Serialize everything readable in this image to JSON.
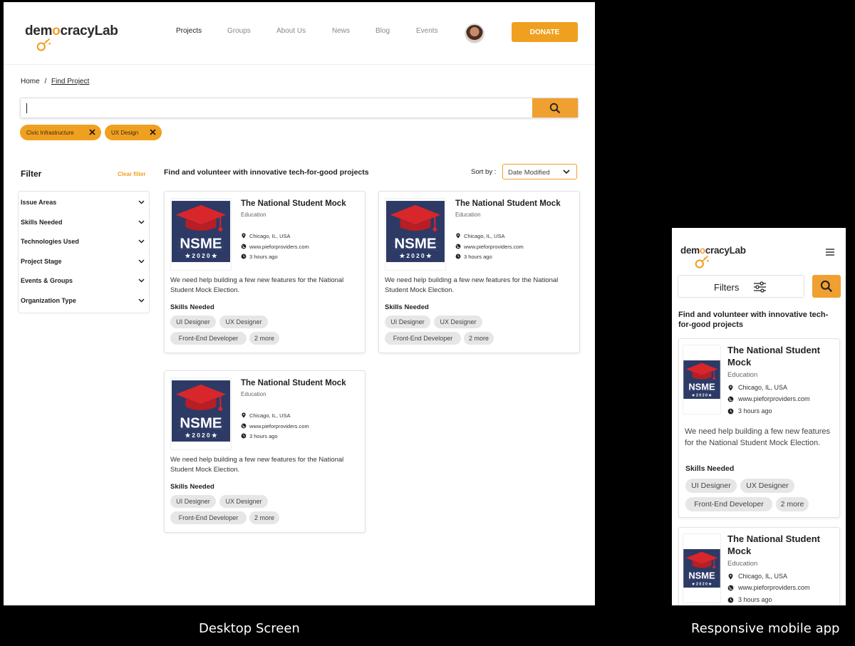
{
  "brand": {
    "logo_text_pre": "dem",
    "logo_text_o": "o",
    "logo_text_post": "cracyLab",
    "accent_color": "#f0a020"
  },
  "nav": {
    "items": [
      "Projects",
      "Groups",
      "About Us",
      "News",
      "Blog",
      "Events"
    ],
    "donate_label": "DONATE"
  },
  "breadcrumb": {
    "home": "Home",
    "separator": "/",
    "current": "Find Project"
  },
  "search": {
    "value": "",
    "icon": "search-icon"
  },
  "active_filters": [
    {
      "label": "Civic Infrastructure"
    },
    {
      "label": "UX Design"
    }
  ],
  "filter": {
    "title": "Filter",
    "clear_label": "Clear filter",
    "sections": [
      "Issue Areas",
      "Skills Needed",
      "Technologies Used",
      "Project Stage",
      "Events & Groups",
      "Organization Type"
    ]
  },
  "results": {
    "headline": "Find and volunteer with innovative tech-for-good projects",
    "sort_label": "Sort by :",
    "sort_value": "Date Modified"
  },
  "project": {
    "title": "The National Student Mock",
    "category": "Education",
    "location": "Chicago, IL, USA",
    "website": "www.pieforproviders.com",
    "updated": "3 hours ago",
    "description": "We need help building a few new features for the National Student Mock Election.",
    "skills_heading": "Skills Needed",
    "skills": [
      "UI Designer",
      "UX Designer",
      "Front-End Developer",
      "2 more"
    ],
    "logo_text": "NSME",
    "logo_year": "★ 2 0 2 0 ★"
  },
  "mobile": {
    "filters_label": "Filters",
    "headline": "Find and volunteer with innovative tech-for-good projects"
  },
  "captions": {
    "desktop": "Desktop Screen",
    "mobile": "Responsive mobile app"
  }
}
